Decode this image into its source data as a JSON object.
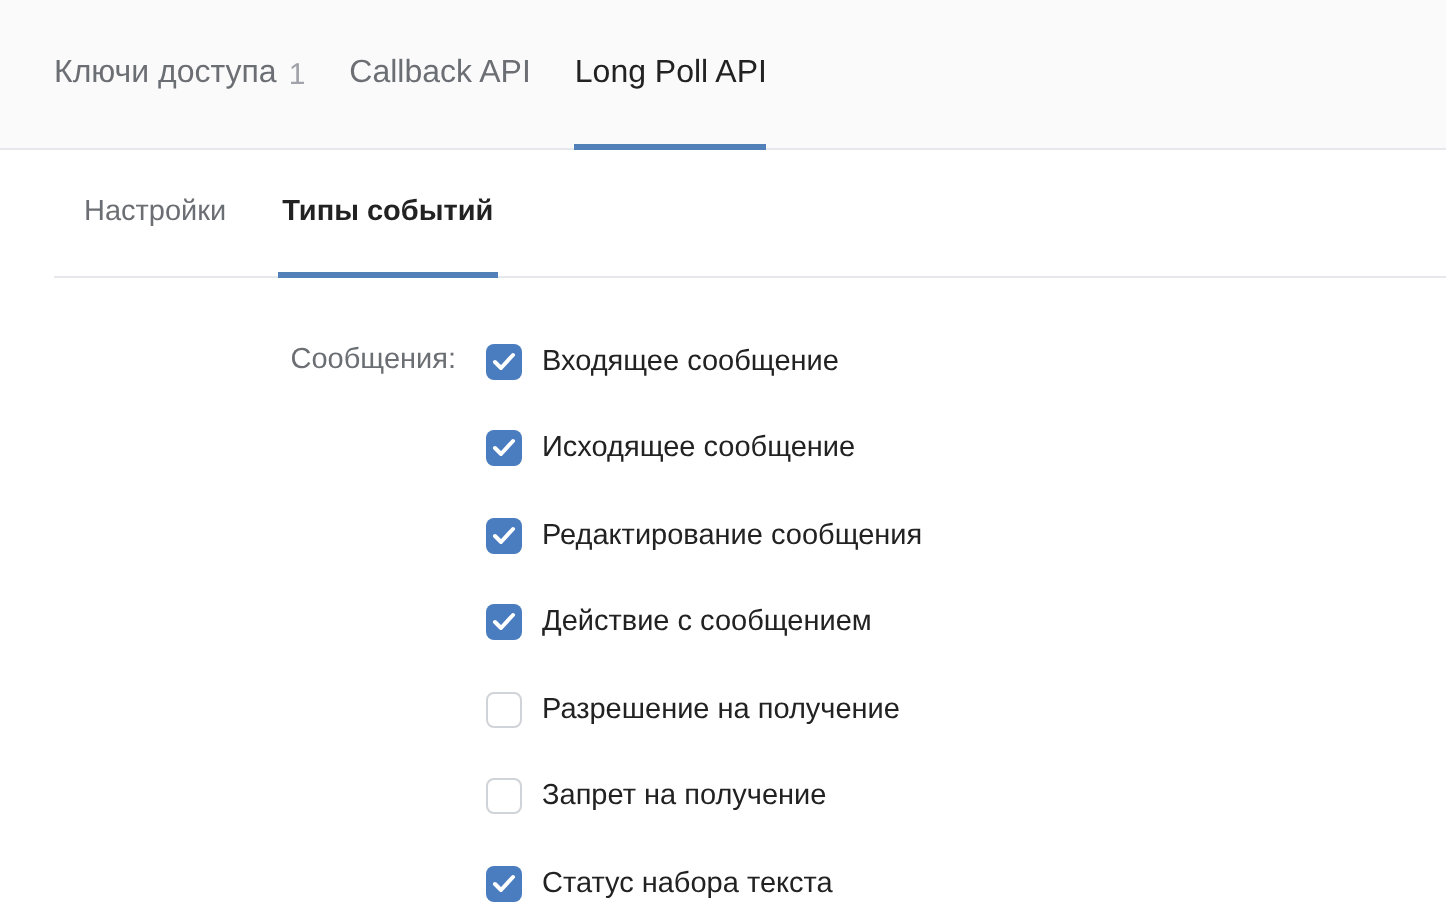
{
  "tabs": [
    {
      "label": "Ключи доступа",
      "count": "1",
      "selected": false
    },
    {
      "label": "Callback API",
      "selected": false
    },
    {
      "label": "Long Poll API",
      "selected": true
    }
  ],
  "subtabs": [
    {
      "label": "Настройки",
      "selected": false
    },
    {
      "label": "Типы событий",
      "selected": true
    }
  ],
  "group": {
    "label": "Сообщения:",
    "options": [
      {
        "label": "Входящее сообщение",
        "checked": true
      },
      {
        "label": "Исходящее сообщение",
        "checked": true
      },
      {
        "label": "Редактирование сообщения",
        "checked": true
      },
      {
        "label": "Действие с сообщением",
        "checked": true
      },
      {
        "label": "Разрешение на получение",
        "checked": false
      },
      {
        "label": "Запрет на получение",
        "checked": false
      },
      {
        "label": "Статус набора текста",
        "checked": true
      }
    ]
  }
}
